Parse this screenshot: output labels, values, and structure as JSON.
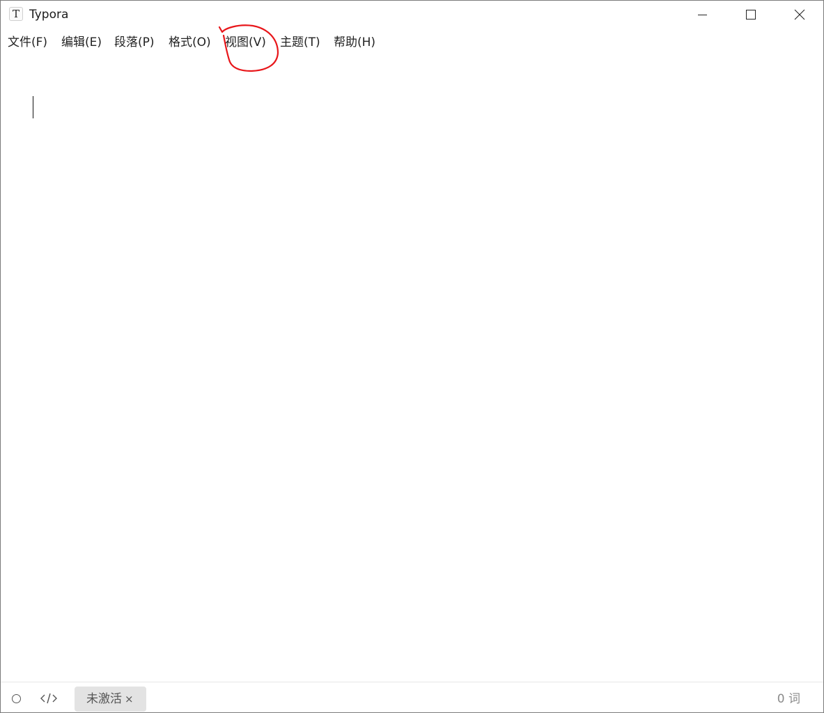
{
  "window": {
    "app_icon_letter": "T",
    "title": "Typora"
  },
  "menu": {
    "items": [
      {
        "label": "文件(F)"
      },
      {
        "label": "编辑(E)"
      },
      {
        "label": "段落(P)"
      },
      {
        "label": "格式(O)"
      },
      {
        "label": "视图(V)"
      },
      {
        "label": "主题(T)"
      },
      {
        "label": "帮助(H)"
      }
    ]
  },
  "annotation": {
    "color": "#e8161a",
    "target": "视图(V)"
  },
  "statusbar": {
    "badge_label": "未激活",
    "badge_close": "×",
    "word_count": "0 词"
  }
}
